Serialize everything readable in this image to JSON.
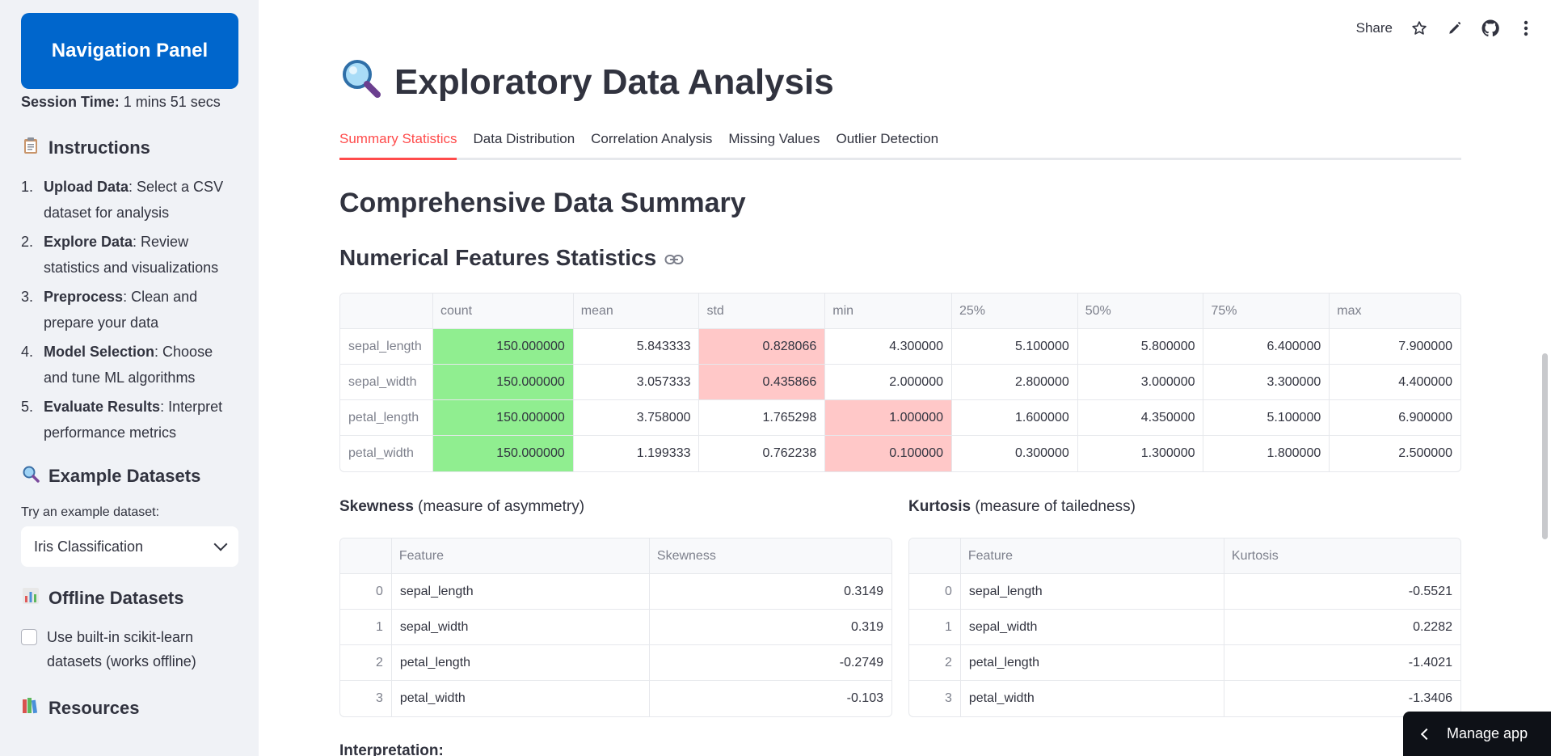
{
  "sidebar": {
    "nav_title": "Navigation Panel",
    "session_label": "Session Time:",
    "session_value": "1 mins 51 secs",
    "instructions_heading": "Instructions",
    "instructions_icon": "clipboard-emoji",
    "instructions": [
      {
        "num": "1.",
        "bold": "Upload Data",
        "rest": ": Select a CSV dataset for analysis"
      },
      {
        "num": "2.",
        "bold": "Explore Data",
        "rest": ": Review statistics and visualizations"
      },
      {
        "num": "3.",
        "bold": "Preprocess",
        "rest": ": Clean and prepare your data"
      },
      {
        "num": "4.",
        "bold": "Model Selection",
        "rest": ": Choose and tune ML algorithms"
      },
      {
        "num": "5.",
        "bold": "Evaluate Results",
        "rest": ": Interpret performance metrics"
      }
    ],
    "example_heading": "Example Datasets",
    "example_icon": "magnifier-emoji",
    "try_label": "Try an example dataset:",
    "select_value": "Iris Classification",
    "offline_heading": "Offline Datasets",
    "offline_icon": "bar-chart-emoji",
    "offline_checkbox_label": "Use built-in scikit-learn datasets (works offline)",
    "offline_checked": false,
    "resources_heading": "Resources",
    "resources_icon": "books-emoji"
  },
  "toolbar": {
    "share_label": "Share",
    "icons": [
      "star-icon",
      "pencil-icon",
      "github-icon",
      "more-vert-icon"
    ]
  },
  "main": {
    "title": "Exploratory Data Analysis",
    "title_icon": "magnifier-emoji",
    "tabs": [
      "Summary Statistics",
      "Data Distribution",
      "Correlation Analysis",
      "Missing Values",
      "Outlier Detection"
    ],
    "active_tab": 0,
    "section_title": "Comprehensive Data Summary",
    "numerical_title": "Numerical Features Statistics",
    "stats": {
      "columns": [
        "",
        "count",
        "mean",
        "std",
        "min",
        "25%",
        "50%",
        "75%",
        "max"
      ],
      "rows": [
        {
          "name": "sepal_length",
          "values": [
            "150.000000",
            "5.843333",
            "0.828066",
            "4.300000",
            "5.100000",
            "5.800000",
            "6.400000",
            "7.900000"
          ]
        },
        {
          "name": "sepal_width",
          "values": [
            "150.000000",
            "3.057333",
            "0.435866",
            "2.000000",
            "2.800000",
            "3.000000",
            "3.300000",
            "4.400000"
          ]
        },
        {
          "name": "petal_length",
          "values": [
            "150.000000",
            "3.758000",
            "1.765298",
            "1.000000",
            "1.600000",
            "4.350000",
            "5.100000",
            "6.900000"
          ]
        },
        {
          "name": "petal_width",
          "values": [
            "150.000000",
            "1.199333",
            "0.762238",
            "0.100000",
            "0.300000",
            "1.300000",
            "1.800000",
            "2.500000"
          ]
        }
      ],
      "highlight_colors": {
        "green": "#90ee90",
        "pink": "#ffc8c8"
      }
    },
    "skewness": {
      "heading_bold": "Skewness",
      "heading_rest": " (measure of asymmetry)",
      "columns": [
        "",
        "Feature",
        "Skewness"
      ],
      "rows": [
        [
          "0",
          "sepal_length",
          "0.3149"
        ],
        [
          "1",
          "sepal_width",
          "0.319"
        ],
        [
          "2",
          "petal_length",
          "-0.2749"
        ],
        [
          "3",
          "petal_width",
          "-0.103"
        ]
      ]
    },
    "kurtosis": {
      "heading_bold": "Kurtosis",
      "heading_rest": " (measure of tailedness)",
      "columns": [
        "",
        "Feature",
        "Kurtosis"
      ],
      "rows": [
        [
          "0",
          "sepal_length",
          "-0.5521"
        ],
        [
          "1",
          "sepal_width",
          "0.2282"
        ],
        [
          "2",
          "petal_length",
          "-1.4021"
        ],
        [
          "3",
          "petal_width",
          "-1.3406"
        ]
      ]
    },
    "interpretation_label": "Interpretation:"
  },
  "manage_app_label": "Manage app",
  "colors": {
    "accent": "#ff4b4b",
    "nav_button": "#0066cc",
    "sidebar_bg": "#f0f2f6",
    "text": "#31333f"
  }
}
